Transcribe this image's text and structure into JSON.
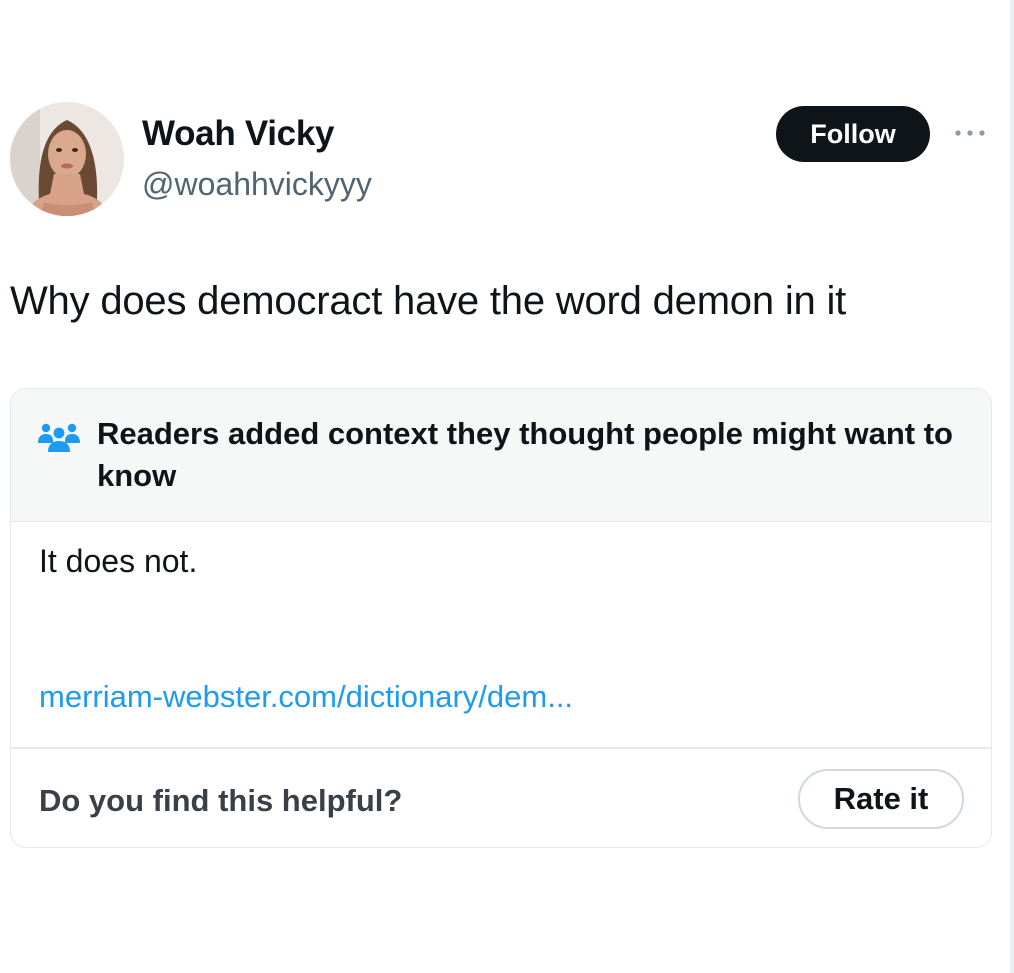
{
  "tweet": {
    "author": {
      "display_name": "Woah Vicky",
      "handle": "@woahhvickyyy"
    },
    "follow_label": "Follow",
    "text": "Why does democract have the word demon in it"
  },
  "community_note": {
    "title": "Readers added context they thought people might want to know",
    "body": "It does not.",
    "link_text": "merriam-webster.com/dictionary/dem...",
    "helpful_question": "Do you find this helpful?",
    "rate_label": "Rate it",
    "icon": "readers-group-icon"
  },
  "colors": {
    "text_primary": "#0f1419",
    "text_secondary": "#536471",
    "link": "#1d9bf0",
    "note_header_bg": "#f6f8f8",
    "border": "#e6e9eb",
    "follow_bg": "#0f1419"
  }
}
